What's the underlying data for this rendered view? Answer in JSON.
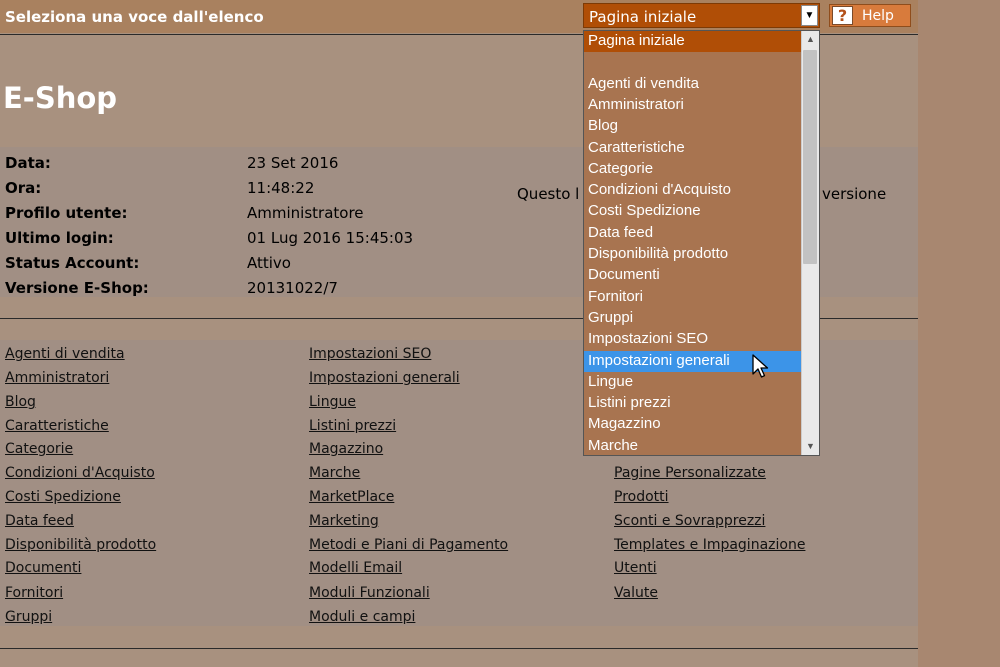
{
  "header": {
    "title": "Seleziona una voce dall'elenco",
    "select_value": "Pagina iniziale",
    "help_icon": "?",
    "help_label": "Help"
  },
  "brand": "E-Shop",
  "info": {
    "rows": [
      {
        "label": "Data:",
        "value": "23 Set 2016"
      },
      {
        "label": "Ora:",
        "value": "11:48:22"
      },
      {
        "label": "Profilo utente:",
        "value": "Amministratore"
      },
      {
        "label": "Ultimo login:",
        "value": "01 Lug 2016 15:45:03"
      },
      {
        "label": "Status Account:",
        "value": "Attivo"
      },
      {
        "label": "Versione E-Shop:",
        "value": "20131022/7"
      }
    ],
    "notice_start": "Questo l",
    "notice_end": "versione"
  },
  "links": {
    "col1": [
      "Agenti di vendita",
      "Amministratori",
      "Blog",
      "Caratteristiche",
      "Categorie",
      "Condizioni d'Acquisto",
      "Costi Spedizione",
      "Data feed",
      "Disponibilità prodotto",
      "Documenti",
      "Fornitori",
      "Gruppi"
    ],
    "col2": [
      "Impostazioni SEO",
      "Impostazioni generali",
      "Lingue",
      "Listini prezzi",
      "Magazzino",
      "Marche",
      "MarketPlace",
      "Marketing",
      "Metodi e Piani di Pagamento",
      "Modelli Email",
      "Moduli Funzionali",
      "Moduli e campi"
    ],
    "col3": [
      "Pagine Personalizzate",
      "Prodotti",
      "Sconti e Sovrapprezzi",
      "Templates e Impaginazione",
      "Utenti",
      "Valute"
    ]
  },
  "dropdown": {
    "items": [
      "Pagina iniziale",
      "",
      "Agenti di vendita",
      "Amministratori",
      "Blog",
      "Caratteristiche",
      "Categorie",
      "Condizioni d'Acquisto",
      "Costi Spedizione",
      "Data feed",
      "Disponibilità prodotto",
      "Documenti",
      "Fornitori",
      "Gruppi",
      "Impostazioni SEO",
      "Impostazioni generali",
      "Lingue",
      "Listini prezzi",
      "Magazzino",
      "Marche"
    ],
    "selected": "Pagina iniziale",
    "hovered": "Impostazioni generali"
  }
}
